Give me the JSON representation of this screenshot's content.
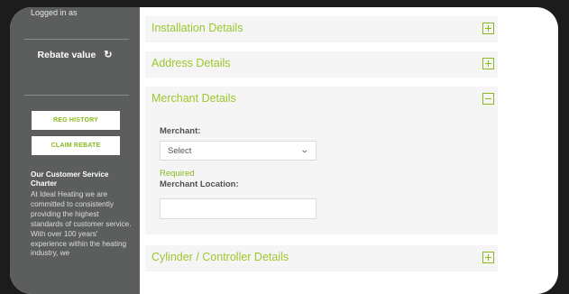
{
  "sidebar": {
    "logged_in_label": "Logged in as",
    "rebate_label": "Rebate value",
    "reg_history_button": "REG HISTORY",
    "claim_rebate_button": "CLAIM REBATE",
    "charter_title": "Our Customer Service Charter",
    "charter_text": "At Ideal Heating we are committed to consistently providing the highest standards of customer service. With over 100 years' experience within the heating industry, we"
  },
  "sections": {
    "installation_title": "Installation Details",
    "address_title": "Address Details",
    "merchant_title": "Merchant Details",
    "cylinder_title": "Cylinder / Controller Details"
  },
  "merchant_form": {
    "merchant_label": "Merchant:",
    "merchant_select_value": "Select",
    "required_text": "Required",
    "location_label": "Merchant Location:",
    "location_value": ""
  },
  "colors": {
    "accent": "#8ab81f",
    "sidebar_bg": "#5b5e5c",
    "panel_bg": "#f5f5f5",
    "outer_bg": "#1c1c1c"
  },
  "icons": {
    "refresh": "refresh-icon",
    "expand": "plus-square-icon",
    "collapse": "minus-square-icon",
    "dropdown": "chevron-down-icon"
  }
}
